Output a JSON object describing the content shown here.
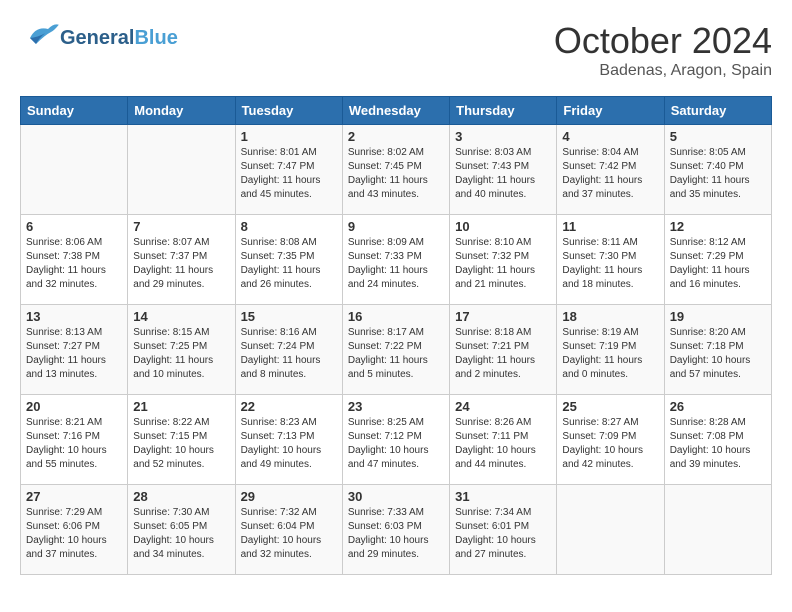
{
  "header": {
    "logo_line1": "General",
    "logo_line2": "Blue",
    "month": "October 2024",
    "location": "Badenas, Aragon, Spain"
  },
  "days_of_week": [
    "Sunday",
    "Monday",
    "Tuesday",
    "Wednesday",
    "Thursday",
    "Friday",
    "Saturday"
  ],
  "weeks": [
    [
      {
        "day": "",
        "info": ""
      },
      {
        "day": "",
        "info": ""
      },
      {
        "day": "1",
        "info": "Sunrise: 8:01 AM\nSunset: 7:47 PM\nDaylight: 11 hours and 45 minutes."
      },
      {
        "day": "2",
        "info": "Sunrise: 8:02 AM\nSunset: 7:45 PM\nDaylight: 11 hours and 43 minutes."
      },
      {
        "day": "3",
        "info": "Sunrise: 8:03 AM\nSunset: 7:43 PM\nDaylight: 11 hours and 40 minutes."
      },
      {
        "day": "4",
        "info": "Sunrise: 8:04 AM\nSunset: 7:42 PM\nDaylight: 11 hours and 37 minutes."
      },
      {
        "day": "5",
        "info": "Sunrise: 8:05 AM\nSunset: 7:40 PM\nDaylight: 11 hours and 35 minutes."
      }
    ],
    [
      {
        "day": "6",
        "info": "Sunrise: 8:06 AM\nSunset: 7:38 PM\nDaylight: 11 hours and 32 minutes."
      },
      {
        "day": "7",
        "info": "Sunrise: 8:07 AM\nSunset: 7:37 PM\nDaylight: 11 hours and 29 minutes."
      },
      {
        "day": "8",
        "info": "Sunrise: 8:08 AM\nSunset: 7:35 PM\nDaylight: 11 hours and 26 minutes."
      },
      {
        "day": "9",
        "info": "Sunrise: 8:09 AM\nSunset: 7:33 PM\nDaylight: 11 hours and 24 minutes."
      },
      {
        "day": "10",
        "info": "Sunrise: 8:10 AM\nSunset: 7:32 PM\nDaylight: 11 hours and 21 minutes."
      },
      {
        "day": "11",
        "info": "Sunrise: 8:11 AM\nSunset: 7:30 PM\nDaylight: 11 hours and 18 minutes."
      },
      {
        "day": "12",
        "info": "Sunrise: 8:12 AM\nSunset: 7:29 PM\nDaylight: 11 hours and 16 minutes."
      }
    ],
    [
      {
        "day": "13",
        "info": "Sunrise: 8:13 AM\nSunset: 7:27 PM\nDaylight: 11 hours and 13 minutes."
      },
      {
        "day": "14",
        "info": "Sunrise: 8:15 AM\nSunset: 7:25 PM\nDaylight: 11 hours and 10 minutes."
      },
      {
        "day": "15",
        "info": "Sunrise: 8:16 AM\nSunset: 7:24 PM\nDaylight: 11 hours and 8 minutes."
      },
      {
        "day": "16",
        "info": "Sunrise: 8:17 AM\nSunset: 7:22 PM\nDaylight: 11 hours and 5 minutes."
      },
      {
        "day": "17",
        "info": "Sunrise: 8:18 AM\nSunset: 7:21 PM\nDaylight: 11 hours and 2 minutes."
      },
      {
        "day": "18",
        "info": "Sunrise: 8:19 AM\nSunset: 7:19 PM\nDaylight: 11 hours and 0 minutes."
      },
      {
        "day": "19",
        "info": "Sunrise: 8:20 AM\nSunset: 7:18 PM\nDaylight: 10 hours and 57 minutes."
      }
    ],
    [
      {
        "day": "20",
        "info": "Sunrise: 8:21 AM\nSunset: 7:16 PM\nDaylight: 10 hours and 55 minutes."
      },
      {
        "day": "21",
        "info": "Sunrise: 8:22 AM\nSunset: 7:15 PM\nDaylight: 10 hours and 52 minutes."
      },
      {
        "day": "22",
        "info": "Sunrise: 8:23 AM\nSunset: 7:13 PM\nDaylight: 10 hours and 49 minutes."
      },
      {
        "day": "23",
        "info": "Sunrise: 8:25 AM\nSunset: 7:12 PM\nDaylight: 10 hours and 47 minutes."
      },
      {
        "day": "24",
        "info": "Sunrise: 8:26 AM\nSunset: 7:11 PM\nDaylight: 10 hours and 44 minutes."
      },
      {
        "day": "25",
        "info": "Sunrise: 8:27 AM\nSunset: 7:09 PM\nDaylight: 10 hours and 42 minutes."
      },
      {
        "day": "26",
        "info": "Sunrise: 8:28 AM\nSunset: 7:08 PM\nDaylight: 10 hours and 39 minutes."
      }
    ],
    [
      {
        "day": "27",
        "info": "Sunrise: 7:29 AM\nSunset: 6:06 PM\nDaylight: 10 hours and 37 minutes."
      },
      {
        "day": "28",
        "info": "Sunrise: 7:30 AM\nSunset: 6:05 PM\nDaylight: 10 hours and 34 minutes."
      },
      {
        "day": "29",
        "info": "Sunrise: 7:32 AM\nSunset: 6:04 PM\nDaylight: 10 hours and 32 minutes."
      },
      {
        "day": "30",
        "info": "Sunrise: 7:33 AM\nSunset: 6:03 PM\nDaylight: 10 hours and 29 minutes."
      },
      {
        "day": "31",
        "info": "Sunrise: 7:34 AM\nSunset: 6:01 PM\nDaylight: 10 hours and 27 minutes."
      },
      {
        "day": "",
        "info": ""
      },
      {
        "day": "",
        "info": ""
      }
    ]
  ]
}
